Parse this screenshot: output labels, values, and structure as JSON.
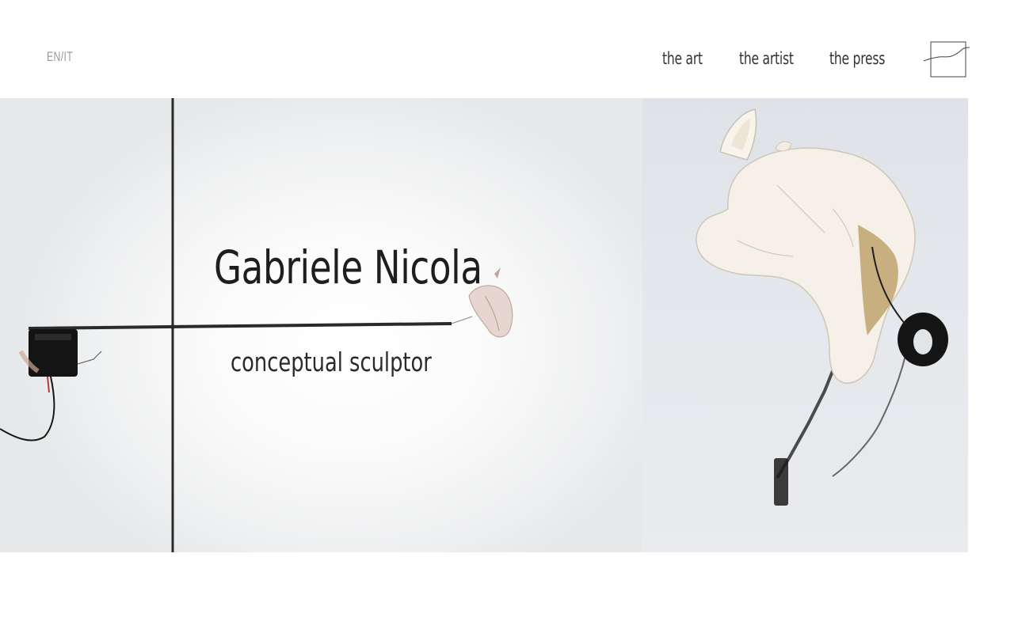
{
  "header": {
    "language_switch": "EN/IT",
    "nav": [
      {
        "label": "the art"
      },
      {
        "label": "the artist"
      },
      {
        "label": "the press"
      }
    ],
    "logo_icon": "signature-line-box-icon"
  },
  "hero": {
    "title": "Gabriele Nicola",
    "subtitle": "conceptual sculptor",
    "left_image": "wire-sculpture-with-rose-petal",
    "right_image": "white-ceramic-animal-head-sculpture"
  },
  "colors": {
    "text": "#222222",
    "lang": "#9a9a9a",
    "background": "#ffffff"
  }
}
